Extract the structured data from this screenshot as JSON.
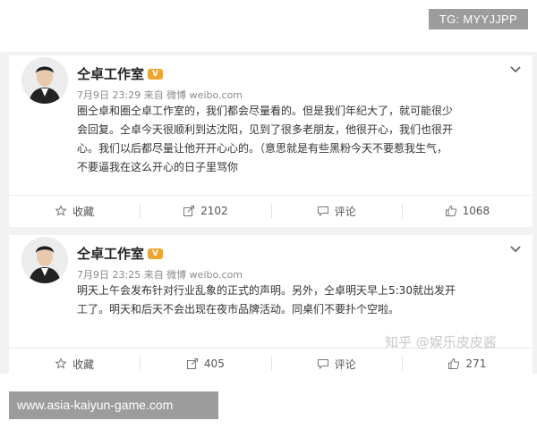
{
  "tg_badge": "TG: MYYJJPP",
  "posts": [
    {
      "author": "仝卓工作室",
      "meta": "7月9日 23:29 来自 微博 weibo.com",
      "text_lines": [
        "圈仝卓和圈仝卓工作室的，我们都会尽量看的。但是我们年纪大了，就可能很少",
        "会回复。仝卓今天很顺利到达沈阳，见到了很多老朋友，他很开心，我们也很开",
        "心。我们以后都尽量让他开开心心的。（意思就是有些黑粉今天不要惹我生气，",
        "不要逼我在这么开心的日子里骂你"
      ],
      "actions": {
        "favorite": "收藏",
        "repost": "2102",
        "comment": "评论",
        "like": "1068"
      }
    },
    {
      "author": "仝卓工作室",
      "meta": "7月9日 23:25 来自 微博 weibo.com",
      "text_lines": [
        "明天上午会发布针对行业乱象的正式的声明。另外，仝卓明天早上5:30就出发开",
        "工了。明天和后天不会出现在夜市品牌活动。同桌们不要扑个空啦。"
      ],
      "actions": {
        "favorite": "收藏",
        "repost": "405",
        "comment": "评论",
        "like": "271"
      }
    }
  ],
  "watermark": "知乎 @娱乐皮皮酱",
  "site_badge": "www.asia-kaiyun-game.com"
}
